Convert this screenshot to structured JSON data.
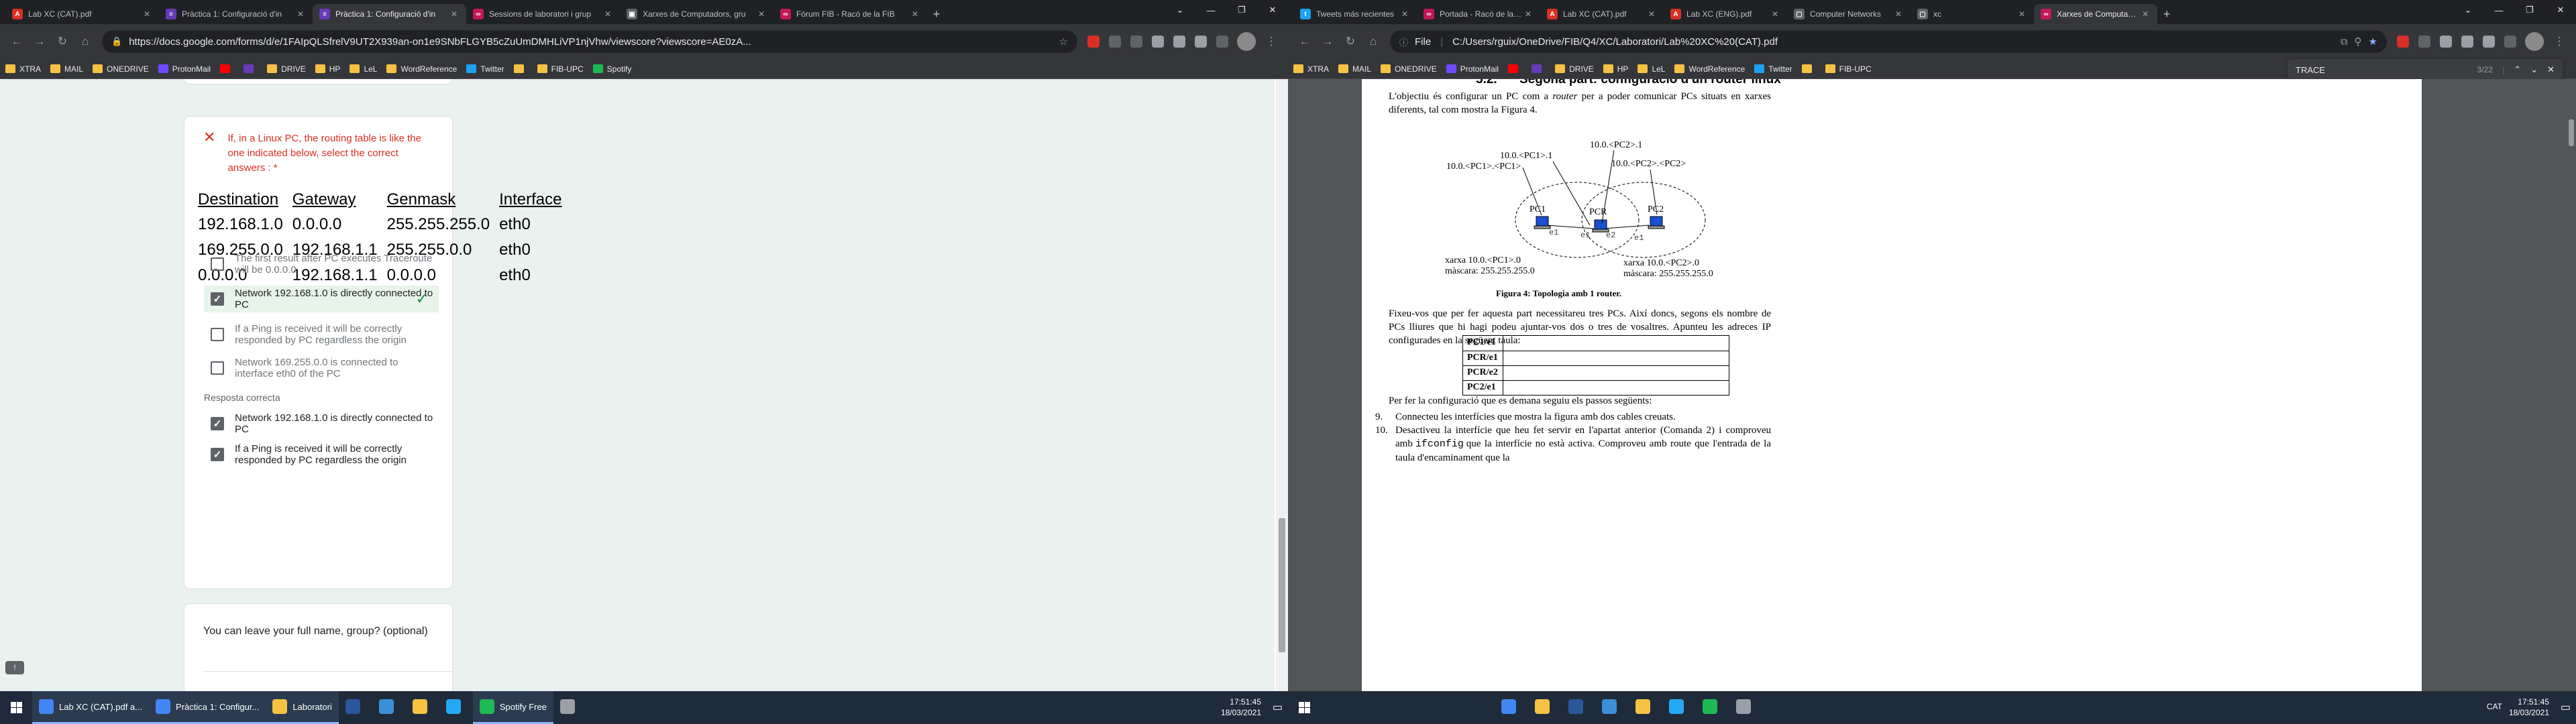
{
  "left": {
    "tabs": [
      {
        "title": "Lab XC (CAT).pdf",
        "color": "#d93025",
        "glyph": "A"
      },
      {
        "title": "Pràctica 1: Configuració d'in",
        "color": "#673ab7",
        "glyph": "≡"
      },
      {
        "title": "Pràctica 1: Configuració d'in",
        "color": "#673ab7",
        "glyph": "≡",
        "active": true
      },
      {
        "title": "Sessions de laboratori i grup",
        "color": "#c2185b",
        "glyph": "∞"
      },
      {
        "title": "Xarxes de Computadors, gru",
        "color": "#5f6368",
        "glyph": "▣"
      },
      {
        "title": "Fòrum FIB - Racó de la FIB",
        "color": "#c2185b",
        "glyph": "∞"
      }
    ],
    "url": "https://docs.google.com/forms/d/e/1FAIpQLSfrelV9UT2X939an-on1e9SNbFLGYB5cZuUmDMHLiVP1njVhw/viewscore?viewscore=AE0zA...",
    "bookmarks": [
      "XTRA",
      "MAIL",
      "ONEDRIVE",
      "ProtonMail",
      "",
      "",
      "DRIVE",
      "HP",
      "LeL",
      "WordReference",
      "Twitter",
      "",
      "FIB-UPC",
      "Spotify"
    ],
    "form": {
      "question": "If, in a Linux PC, the routing table is like the one indicated below, select the correct answers :",
      "required_mark": " *",
      "table_headers": [
        "Destination",
        "Gateway",
        "Genmask",
        "Interface"
      ],
      "table_rows": [
        [
          "192.168.1.0",
          "0.0.0.0",
          "255.255.255.0",
          "eth0"
        ],
        [
          "169.255.0.0",
          "192.168.1.1",
          "255.255.0.0",
          "eth0"
        ],
        [
          "0.0.0.0",
          "192.168.1.1",
          "0.0.0.0",
          "eth0"
        ]
      ],
      "options": [
        {
          "label": "The first result after PC executes Traceroute will be 0.0.0.0",
          "checked": false,
          "correct": false
        },
        {
          "label": "Network 192.168.1.0 is directly connected to PC",
          "checked": true,
          "correct": true
        },
        {
          "label": "If a Ping is received it will be correctly responded by PC regardless the origin",
          "checked": false,
          "correct": false
        },
        {
          "label": "Network 169.255.0.0 is connected to interface eth0 of the PC",
          "checked": false,
          "correct": false
        }
      ],
      "correct_title": "Resposta correcta",
      "correct_answers": [
        "Network 192.168.1.0 is directly connected to PC",
        "If a Ping is received it will be correctly responded by PC regardless the origin"
      ],
      "name_question": "You can leave your full name, group? (optional)"
    },
    "taskbar": {
      "items": [
        {
          "label": "Lab XC (CAT).pdf a...",
          "color": "#4285f4"
        },
        {
          "label": "Pràctica 1: Configur...",
          "color": "#4285f4"
        },
        {
          "label": "Laboratori",
          "color": "#f6c244"
        },
        {
          "label": "",
          "color": "#2b579a"
        },
        {
          "label": "",
          "color": "#3c8fd6"
        },
        {
          "label": "",
          "color": "#f6c244"
        },
        {
          "label": "",
          "color": "#23a9f2"
        },
        {
          "label": "Spotify Free",
          "color": "#1db954"
        },
        {
          "label": "",
          "color": "#9aa0a6"
        }
      ],
      "time": "17:51:45",
      "date": "18/03/2021"
    }
  },
  "right": {
    "tabs": [
      {
        "title": "Tweets más recientes",
        "color": "#1da1f2",
        "glyph": "t"
      },
      {
        "title": "Portada - Racó de la FIB",
        "color": "#c2185b",
        "glyph": "∞"
      },
      {
        "title": "Lab XC (CAT).pdf",
        "color": "#d93025",
        "glyph": "A"
      },
      {
        "title": "Lab XC (ENG).pdf",
        "color": "#d93025",
        "glyph": "A"
      },
      {
        "title": "Computer Networks",
        "color": "#5f6368",
        "glyph": "▢"
      },
      {
        "title": "xc",
        "color": "#5f6368",
        "glyph": "▢"
      },
      {
        "title": "Xarxes de Computado...",
        "color": "#c2185b",
        "glyph": "∞",
        "active": true
      }
    ],
    "file_label": "File",
    "url": "C:/Users/rguix/OneDrive/FIB/Q4/XC/Laboratori/Lab%20XC%20(CAT).pdf",
    "find": {
      "query": "TRACE",
      "count": "3/22"
    },
    "bookmarks": [
      "XTRA",
      "MAIL",
      "ONEDRIVE",
      "ProtonMail",
      "",
      "",
      "DRIVE",
      "HP",
      "LeL",
      "WordReference",
      "Twitter",
      "",
      "FIB-UPC"
    ],
    "pdf": {
      "section_num": "5.2.",
      "section_title": "Segona part: configuració d'un router linux",
      "intro1": "L'objectiu és configurar un PC com a",
      "intro_em": "router",
      "intro2": "per a poder comunicar PCs situats en xarxes diferents, tal com mostra la Figura 4.",
      "fig": {
        "pc1_pc1": "10.0.<PC1>.<PC1>",
        "pc1_1": "10.0.<PC1>.1",
        "pc2_1": "10.0.<PC2>.1",
        "pc2_pc2": "10.0.<PC2>.<PC2>",
        "pc1": "PC1",
        "pcr": "PCR",
        "pc2": "PC2",
        "e1a": "e1",
        "e1b": "e1",
        "e2": "e2",
        "e1c": "e1",
        "net1": "xarxa 10.0.<PC1>.0",
        "mask1": "màscara: 255.255.255.0",
        "net2": "xarxa 10.0.<PC2>.0",
        "mask2": "màscara: 255.255.255.0",
        "caption": "Figura 4: Topologia amb 1 router."
      },
      "para2": "Fixeu-vos que per fer aquesta part necessitareu tres PCs. Així doncs, segons els nombre de PCs lliures que hi hagi podeu ajuntar-vos dos o tres de vosaltres. Apunteu les adreces IP configurades en la següent taula:",
      "ip_rows": [
        "PC1/e1",
        "PCR/e1",
        "PCR/e2",
        "PC2/e1"
      ],
      "para3": "Per fer la configuració que es demana seguiu els passos següents:",
      "steps": [
        {
          "n": "9.",
          "text": "Connecteu les interfícies que mostra la figura amb dos cables creuats."
        },
        {
          "n": "10.",
          "text": "Desactiveu la interfície que heu fet servir en l'apartat anterior (Comanda 2) i comproveu amb",
          "code": "ifconfig",
          "tail": "que la interfície no està activa. Comproveu amb route que l'entrada de la taula d'encaminament que la"
        }
      ]
    },
    "taskbar": {
      "tray_lang": "CAT",
      "time": "17:51:45",
      "date": "18/03/2021"
    }
  }
}
